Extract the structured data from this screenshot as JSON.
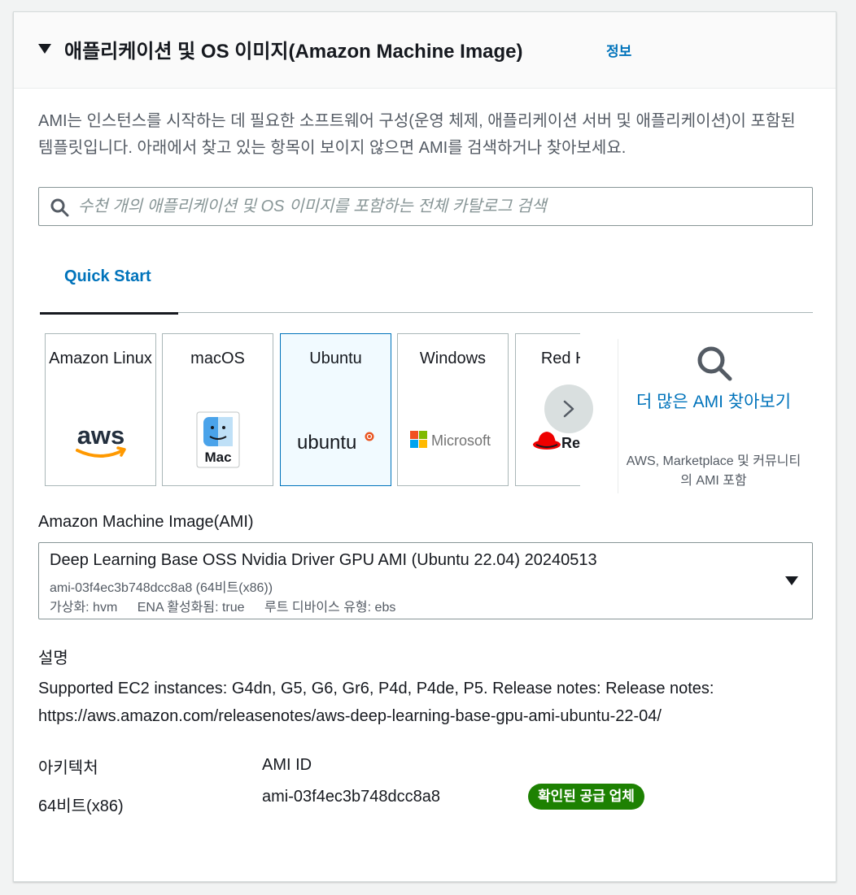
{
  "header": {
    "title": "애플리케이션 및 OS 이미지(Amazon Machine Image)",
    "info_link": "정보"
  },
  "description": "AMI는 인스턴스를 시작하는 데 필요한 소프트웨어 구성(운영 체제, 애플리케이션 서버 및 애플리케이션)이 포함된 템플릿입니다. 아래에서 찾고 있는 항목이 보이지 않으면 AMI를 검색하거나 찾아보세요.",
  "search": {
    "placeholder": "수천 개의 애플리케이션 및 OS 이미지를 포함하는 전체 카탈로그 검색",
    "value": ""
  },
  "tabs": [
    {
      "label": "Quick Start",
      "active": true
    }
  ],
  "quick_start": {
    "cards": [
      {
        "label": "Amazon Linux",
        "logo": "aws-logo",
        "logo_text": "aws",
        "selected": false
      },
      {
        "label": "macOS",
        "logo": "mac-finder-logo",
        "logo_text": "Mac",
        "selected": false
      },
      {
        "label": "Ubuntu",
        "logo": "ubuntu-logo",
        "logo_text": "ubuntu",
        "selected": true
      },
      {
        "label": "Windows",
        "logo": "microsoft-logo",
        "logo_text": "Microsoft",
        "selected": false
      },
      {
        "label": "Red Hat",
        "logo": "redhat-logo",
        "logo_text": "Red Hat",
        "selected": false
      }
    ],
    "next_icon": "chevron-right-icon",
    "browse_more": {
      "icon": "search-icon",
      "link": "더 많은 AMI 찾아보기",
      "subtext": "AWS, Marketplace 및 커뮤니티의 AMI 포함"
    }
  },
  "ami": {
    "label": "Amazon Machine Image(AMI)",
    "selected_name": "Deep Learning Base OSS Nvidia Driver GPU AMI (Ubuntu 22.04) 20240513",
    "selected_meta": "ami-03f4ec3b748dcc8a8 (64비트(x86))",
    "virtualization": "가상화: hvm",
    "ena": "ENA 활성화됨: true",
    "root_device": "루트 디바이스 유형: ebs"
  },
  "details": {
    "description_label": "설명",
    "description_text": "Supported EC2 instances: G4dn, G5, G6, Gr6, P4d, P4de, P5. Release notes: Release notes: https://aws.amazon.com/releasenotes/aws-deep-learning-base-gpu-ami-ubuntu-22-04/",
    "architecture_label": "아키텍처",
    "architecture_value": "64비트(x86)",
    "ami_id_label": "AMI ID",
    "ami_id_value": "ami-03f4ec3b748dcc8a8",
    "verified_badge": "확인된 공급 업체"
  },
  "colors": {
    "link": "#0073bb",
    "selected_card_bg": "#f1faff",
    "badge_green": "#1d8102",
    "border": "#879596"
  }
}
